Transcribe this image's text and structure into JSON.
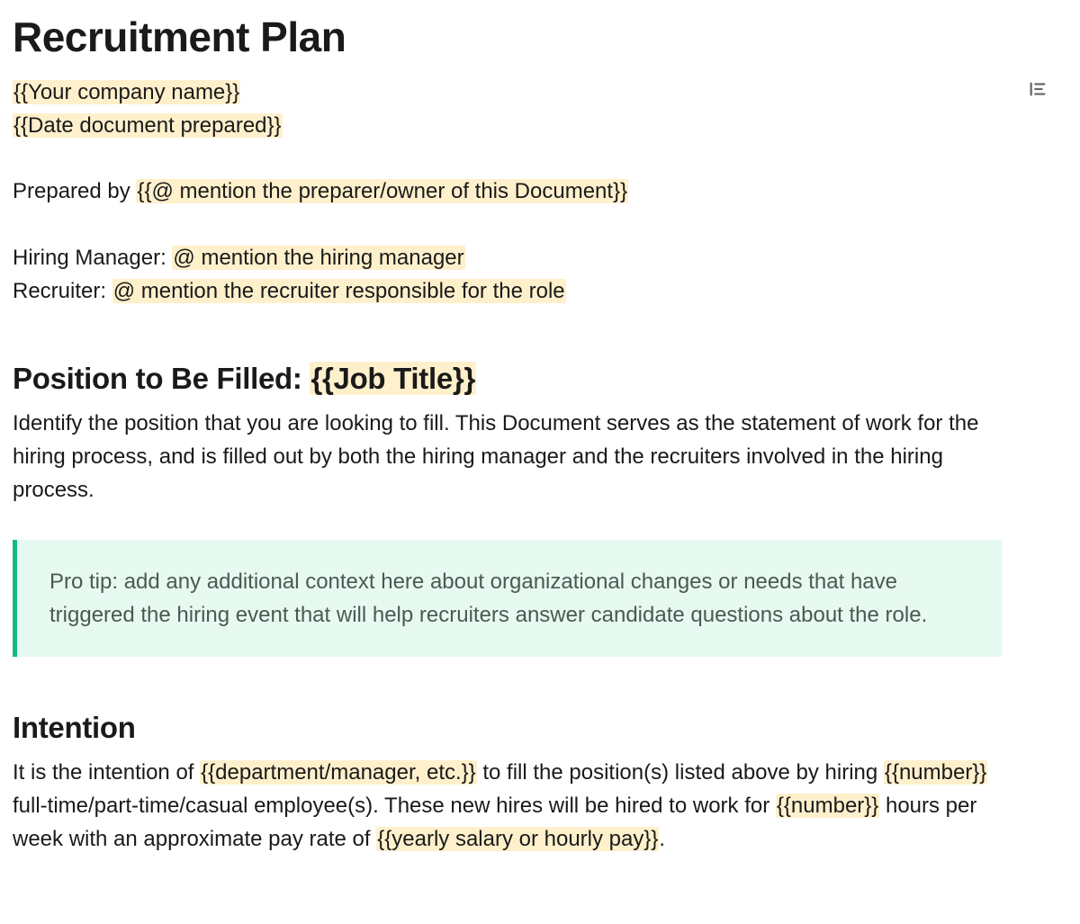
{
  "title": "Recruitment Plan",
  "company_placeholder": "{{Your company name}}",
  "date_placeholder": "{{Date document prepared}}",
  "prepared_by_label": "Prepared by ",
  "prepared_by_placeholder": "{{@ mention the preparer/owner of this Document}}",
  "hiring_manager_label": "Hiring Manager: ",
  "hiring_manager_placeholder": "@ mention the hiring manager",
  "recruiter_label": "Recruiter: ",
  "recruiter_placeholder": "@ mention the recruiter responsible for the role",
  "position_heading_prefix": "Position to Be Filled: ",
  "position_heading_placeholder": "{{Job Title}}",
  "position_body": "Identify the position that you are looking to fill. This Document serves as the statement of work for the hiring process, and is filled out by both the hiring manager and the recruiters involved in the hiring process.",
  "tip": "Pro tip: add any additional context here about organizational changes or needs that have triggered the hiring event that will help recruiters answer candidate questions about the role.",
  "intention_heading": "Intention",
  "intention": {
    "t1": "It is the intention of ",
    "p1": "{{department/manager, etc.}}",
    "t2": " to fill the position(s) listed above by hiring ",
    "p2": "{{number}}",
    "t3": " full-time/part-time/casual employee(s). These new hires will be hired to work for ",
    "p3": "{{number}}",
    "t4": " hours per week with an approximate pay rate of ",
    "p4": "{{yearly salary or hourly pay}}",
    "t5": "."
  }
}
